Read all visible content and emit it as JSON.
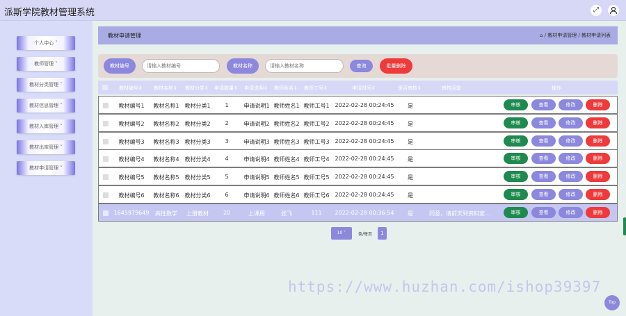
{
  "app": {
    "title": "派斯学院教材管理系统"
  },
  "topbar": {
    "fullscreen_icon": "expand-icon",
    "user_icon": "user-icon"
  },
  "sidebar": {
    "items": [
      {
        "label": "个人中心 ˅"
      },
      {
        "label": "教师管理 ˅"
      },
      {
        "label": "教材分类管理 ˅"
      },
      {
        "label": "教材信息管理 ˅"
      },
      {
        "label": "教材入库管理 ˅"
      },
      {
        "label": "教材出库管理 ˅"
      },
      {
        "label": "教材申请管理 ˅"
      }
    ]
  },
  "header": {
    "title": "教材申请管理",
    "breadcrumb": "⌂ / 教材申请管理 / 教材申请列表"
  },
  "search": {
    "code_label": "教材编号",
    "code_placeholder": "请输入教材编号",
    "name_label": "教材名称",
    "name_placeholder": "请输入教材名称",
    "query_button": "查询",
    "batch_delete_button": "批量删除"
  },
  "colors": {
    "accent": "#8c88dd",
    "success": "#1e8a4f",
    "danger": "#ee3a3a",
    "header": "#a9abe4"
  },
  "table": {
    "columns": [
      "教材编号⇕",
      "教材名称⇕",
      "教材分类⇕",
      "申请数量⇕",
      "申请说明⇕",
      "教师姓名⇕",
      "教师工号⇕",
      "申请时间⇕",
      "是否审核⇕",
      "审核回复",
      "操作"
    ],
    "actions": {
      "audit": "审核",
      "view": "查看",
      "edit": "修改",
      "delete": "删除"
    },
    "rows": [
      {
        "code": "教材编号1",
        "name": "教材名称1",
        "category": "教材分类1",
        "qty": "1",
        "desc": "申请说明1",
        "teacher": "教师姓名1",
        "tno": "教师工号1",
        "time": "2022-02-28 00:24:45",
        "audited": "是",
        "reply": ""
      },
      {
        "code": "教材编号2",
        "name": "教材名称2",
        "category": "教材分类2",
        "qty": "2",
        "desc": "申请说明2",
        "teacher": "教师姓名2",
        "tno": "教师工号2",
        "time": "2022-02-28 00:24:45",
        "audited": "是",
        "reply": ""
      },
      {
        "code": "教材编号3",
        "name": "教材名称3",
        "category": "教材分类3",
        "qty": "3",
        "desc": "申请说明3",
        "teacher": "教师姓名3",
        "tno": "教师工号3",
        "time": "2022-02-28 00:24:45",
        "audited": "是",
        "reply": ""
      },
      {
        "code": "教材编号4",
        "name": "教材名称4",
        "category": "教材分类4",
        "qty": "4",
        "desc": "申请说明4",
        "teacher": "教师姓名4",
        "tno": "教师工号4",
        "time": "2022-02-28 00:24:45",
        "audited": "是",
        "reply": ""
      },
      {
        "code": "教材编号5",
        "name": "教材名称5",
        "category": "教材分类5",
        "qty": "5",
        "desc": "申请说明5",
        "teacher": "教师姓名5",
        "tno": "教师工号5",
        "time": "2022-02-28 00:24:45",
        "audited": "是",
        "reply": ""
      },
      {
        "code": "教材编号6",
        "name": "教材名称6",
        "category": "教材分类6",
        "qty": "6",
        "desc": "申请说明6",
        "teacher": "教师姓名6",
        "tno": "教师工号6",
        "time": "2022-02-28 00:24:45",
        "audited": "是",
        "reply": ""
      },
      {
        "code": "1645979649",
        "name": "高性数学",
        "category": "上册教材",
        "qty": "20",
        "desc": "上课用",
        "teacher": "张飞",
        "tno": "111",
        "time": "2022-02-28 00:36:54",
        "audited": "是",
        "reply": "同意，请前天到资料室..."
      }
    ]
  },
  "pagination": {
    "page_size": "10 ˅",
    "per_page_label": "条/每页",
    "current_page": "1"
  },
  "watermark": "https://www.huzhan.com/ishop39397",
  "top_button": "Top"
}
